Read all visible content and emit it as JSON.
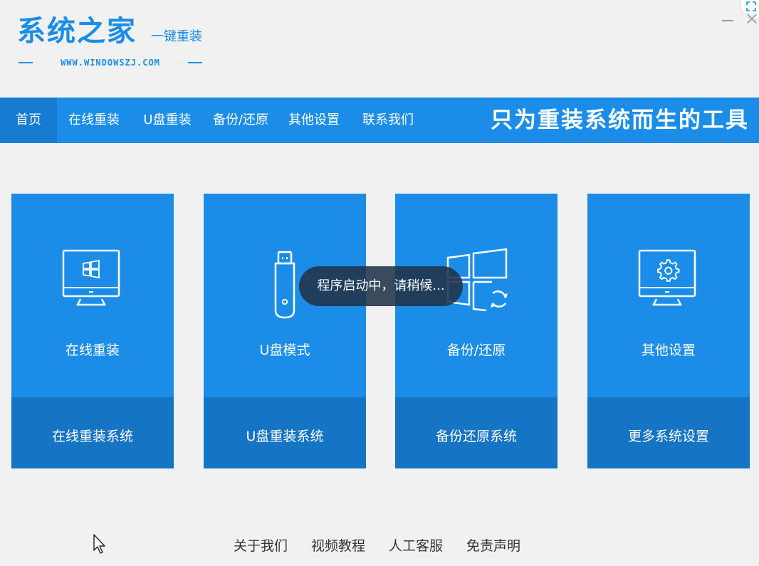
{
  "app": {
    "logo_title": "系统之家",
    "logo_subtitle": "一键重装",
    "logo_url": "WWW.WINDOWSZJ.COM"
  },
  "window": {
    "minimize_label": "–",
    "close_label": "✕"
  },
  "nav": {
    "items": [
      {
        "label": "首页",
        "active": true
      },
      {
        "label": "在线重装",
        "active": false
      },
      {
        "label": "U盘重装",
        "active": false
      },
      {
        "label": "备份/还原",
        "active": false
      },
      {
        "label": "其他设置",
        "active": false
      },
      {
        "label": "联系我们",
        "active": false
      }
    ],
    "slogan": "只为重装系统而生的工具"
  },
  "cards": [
    {
      "icon": "monitor-windows-icon",
      "title": "在线重装",
      "action": "在线重装系统"
    },
    {
      "icon": "usb-drive-icon",
      "title": "U盘模式",
      "action": "U盘重装系统"
    },
    {
      "icon": "windows-restore-icon",
      "title": "备份/还原",
      "action": "备份还原系统"
    },
    {
      "icon": "monitor-settings-icon",
      "title": "其他设置",
      "action": "更多系统设置"
    }
  ],
  "toast": {
    "message": "程序启动中，请稍候..."
  },
  "footer": {
    "links": [
      "关于我们",
      "视频教程",
      "人工客服",
      "免责声明"
    ]
  },
  "colors": {
    "primary": "#1b8de8",
    "card_bottom": "#1574c4",
    "nav_active": "#147bd1",
    "background": "#f1f1f1"
  }
}
